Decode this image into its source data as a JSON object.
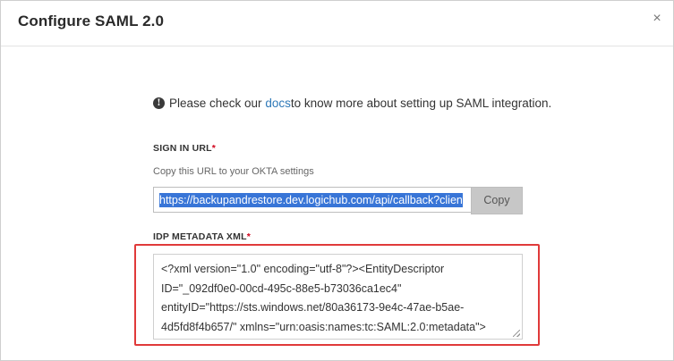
{
  "dialog": {
    "title": "Configure SAML 2.0",
    "close_symbol": "×"
  },
  "info": {
    "icon": "info-icon",
    "before_link": "Please check our ",
    "link_text": "docs",
    "after_link": " to know more about setting up SAML integration."
  },
  "sign_in": {
    "label": "SIGN IN URL",
    "required": "*",
    "hint": "Copy this URL to your OKTA settings",
    "url": "https://backupandrestore.dev.logichub.com/api/callback?clien",
    "copy_label": "Copy"
  },
  "idp": {
    "label": "IDP METADATA XML",
    "required": "*",
    "lines": [
      "<?xml version=\"1.0\" encoding=\"utf-8\"?><EntityDescriptor",
      "ID=\"_092df0e0-00cd-495c-88e5-b73036ca1ec4\"",
      "entityID=\"https://sts.windows.net/80a36173-9e4c-47ae-b5ae-",
      "4d5fd8f4b657/\" xmlns=\"urn:oasis:names:tc:SAML:2.0:metadata\">"
    ]
  },
  "colors": {
    "link": "#2f79b8",
    "required": "#d0021b",
    "highlight_border": "#e03a3a",
    "selection": "#3875d7"
  }
}
